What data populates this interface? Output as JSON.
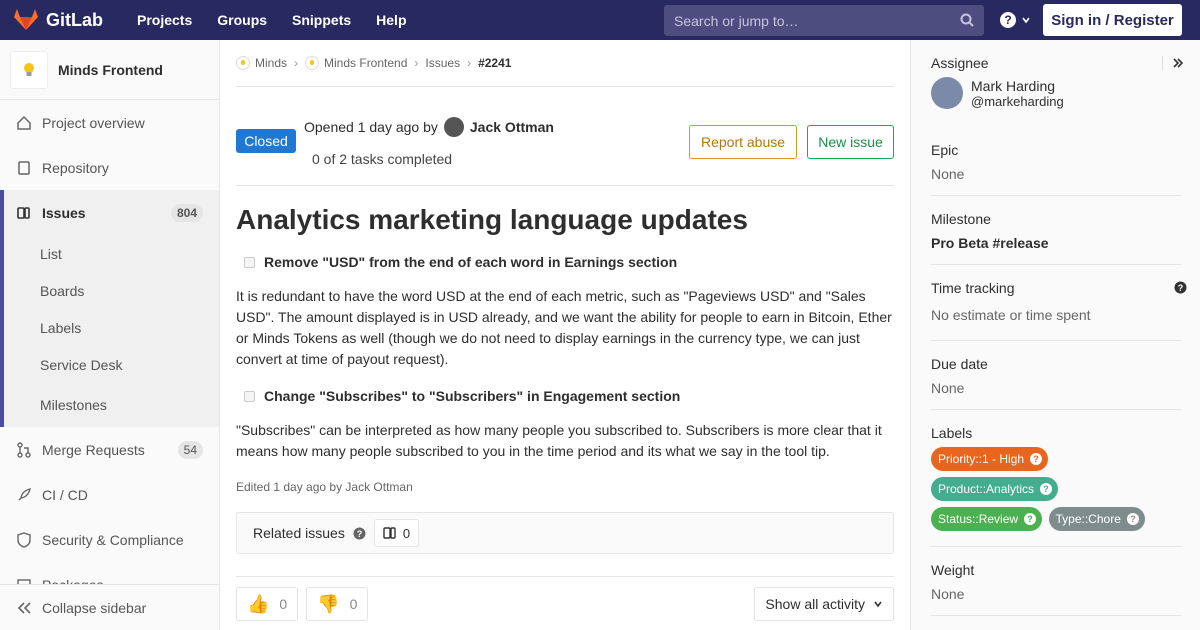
{
  "topnav": {
    "brand": "GitLab",
    "links": [
      "Projects",
      "Groups",
      "Snippets",
      "Help"
    ],
    "search_placeholder": "Search or jump to…",
    "signin": "Sign in / Register"
  },
  "sidebar": {
    "project_name": "Minds Frontend",
    "items": [
      {
        "label": "Project overview"
      },
      {
        "label": "Repository"
      },
      {
        "label": "Issues",
        "count": "804"
      },
      {
        "label": "Merge Requests",
        "count": "54"
      },
      {
        "label": "CI / CD"
      },
      {
        "label": "Security & Compliance"
      },
      {
        "label": "Packages"
      }
    ],
    "subitems": [
      "List",
      "Boards",
      "Labels",
      "Service Desk",
      "Milestones"
    ],
    "collapse": "Collapse sidebar"
  },
  "breadcrumb": [
    "Minds",
    "Minds Frontend",
    "Issues",
    "#2241"
  ],
  "issue": {
    "status": "Closed",
    "opened": "Opened 1 day ago by",
    "author": "Jack Ottman",
    "tasks": "0 of 2 tasks completed",
    "report_abuse": "Report abuse",
    "new_issue": "New issue",
    "title": "Analytics marketing language updates",
    "task1": "Remove \"USD\" from the end of each word in Earnings section",
    "para1": "It is redundant to have the word USD at the end of each metric, such as \"Pageviews USD\" and \"Sales USD\". The amount displayed is in USD already, and we want the ability for people to earn in Bitcoin, Ether or Minds Tokens as well (though we do not need to display earnings in the currency type, we can just convert at time of payout request).",
    "task2": "Change \"Subscribes\" to \"Subscribers\" in Engagement section",
    "para2": "\"Subscribes\" can be interpreted as how many people you subscribed to. Subscribers is more clear that it means how many people subscribed to you in the time period and its what we say in the tool tip.",
    "edited": "Edited 1 day ago by Jack Ottman",
    "related_label": "Related issues",
    "related_count": "0",
    "thumbs_up": "0",
    "thumbs_down": "0",
    "show_all": "Show all activity"
  },
  "right": {
    "assignee_title": "Assignee",
    "assignee_name": "Mark Harding",
    "assignee_user": "@markeharding",
    "epic_title": "Epic",
    "epic_value": "None",
    "milestone_title": "Milestone",
    "milestone_value": "Pro Beta #release",
    "time_title": "Time tracking",
    "time_value": "No estimate or time spent",
    "due_title": "Due date",
    "due_value": "None",
    "labels_title": "Labels",
    "labels": [
      {
        "text": "Priority::1 - High",
        "color": "#e8651e"
      },
      {
        "text": "Product::Analytics",
        "color": "#44ad8e"
      },
      {
        "text": "Status::Review",
        "color": "#4bb04f"
      },
      {
        "text": "Type::Chore",
        "color": "#7f8c8d"
      }
    ],
    "weight_title": "Weight",
    "weight_value": "None"
  }
}
